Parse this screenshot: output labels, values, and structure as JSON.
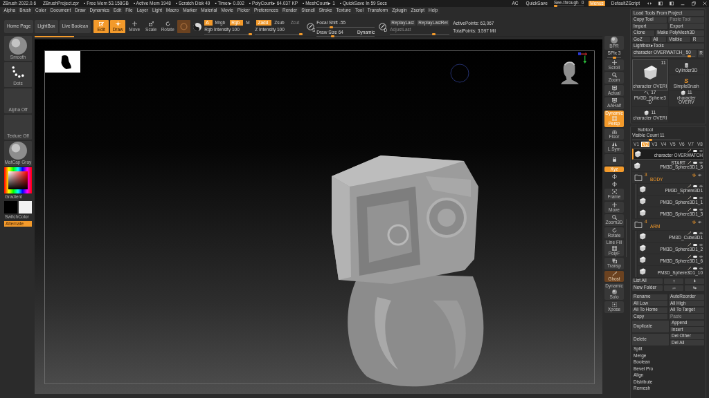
{
  "title_bar": {
    "app": "ZBrush 2022.0.6",
    "project": "ZBrushProject.zpr",
    "stats": [
      "• Free Mem 53.158GB",
      "• Active Mem 1948",
      "• Scratch Disk 49",
      "• Timer▸ 0.002",
      "• PolyCount▸ 64.037 KP",
      "• MeshCount▸ 1",
      "• QuickSave In 59 Secs"
    ],
    "right": {
      "ac": "AC",
      "quicksave": "QuickSave",
      "see_through": {
        "label": "See-through",
        "value": "0",
        "level": 0
      },
      "menus": {
        "label": "Menus",
        "on": true
      },
      "script": "DefaultZScript"
    }
  },
  "menu": [
    "Alpha",
    "Brush",
    "Color",
    "Document",
    "Draw",
    "Dynamics",
    "Edit",
    "File",
    "Layer",
    "Light",
    "Macro",
    "Marker",
    "Material",
    "Movie",
    "Picker",
    "Preferences",
    "Render",
    "Stencil",
    "Stroke",
    "Texture",
    "Tool",
    "Transform",
    "Zplugin",
    "Zscript",
    "Help"
  ],
  "top_shelf": {
    "nav": [
      "Home Page",
      "LightBox",
      "Live Boolean"
    ],
    "modes": [
      {
        "kind": "edit",
        "label": "Edit",
        "selected": true
      },
      {
        "kind": "draw",
        "label": "Draw",
        "selected": true
      },
      {
        "kind": "move",
        "label": "Move",
        "selected": false
      },
      {
        "kind": "scale",
        "label": "Scale",
        "selected": false
      },
      {
        "kind": "rotate",
        "label": "Rotate",
        "selected": false
      }
    ],
    "toggle": {
      "on": true,
      "disabled": true
    },
    "channels": [
      {
        "label": "A",
        "on": true,
        "disabled": false
      },
      {
        "label": "Mrgb",
        "on": false,
        "disabled": false
      },
      {
        "label": "Rgb",
        "on": true,
        "disabled": false
      },
      {
        "label": "M",
        "on": false,
        "disabled": false
      }
    ],
    "z_modes": [
      {
        "label": "Zadd",
        "on": true,
        "disabled": false
      },
      {
        "label": "Zsub",
        "on": false,
        "disabled": false
      },
      {
        "label": "Zcut",
        "on": false,
        "disabled": true
      }
    ],
    "intensity": [
      {
        "label": "Rgb Intensity",
        "value": "100",
        "level": 1
      },
      {
        "label": "Z Intensity",
        "value": "100",
        "level": 1
      }
    ],
    "focal_badge": "S",
    "focal_shift": {
      "label": "Focal Shift",
      "value": "-55",
      "level": 0.24
    },
    "draw_size": {
      "label": "Draw Size",
      "value": "64",
      "level": 0.26,
      "dynamic": "Dynamic"
    },
    "replay_badge": "D",
    "replay": [
      {
        "label": "ReplayLast",
        "disabled": false
      },
      {
        "label": "ReplayLastRel",
        "disabled": false
      }
    ],
    "adjust_last": {
      "label": "AdjustLast",
      "disabled": true,
      "level": 0.75
    },
    "points": [
      "ActivePoints: 63,067",
      "TotalPoints: 3.597 Mil"
    ]
  },
  "left_shelf": {
    "tiles": [
      {
        "kind": "brush",
        "label": "Smooth"
      },
      {
        "kind": "stroke",
        "label": "Dots"
      },
      {
        "kind": "alpha",
        "label": "Alpha Off"
      },
      {
        "kind": "texture",
        "label": "Texture Off"
      },
      {
        "kind": "material",
        "label": "MatCap Gray"
      }
    ],
    "gradient": "Gradient",
    "swatches": [
      {
        "color": "#000000"
      },
      {
        "color": "#f2f2f2"
      }
    ],
    "switch_color": "SwitchColor",
    "alternate": {
      "label": "Alternate",
      "on": true
    }
  },
  "canvas": {
    "progress": {
      "level": 0.07
    }
  },
  "right_shelf": [
    {
      "kind": "sphere",
      "label": "BPR",
      "on": false,
      "disabled": false
    },
    {
      "kind": "slider",
      "label": "SPix 3",
      "level": 0.5
    },
    {
      "kind": "scroll",
      "label": "Scroll",
      "on": false,
      "disabled": false
    },
    {
      "kind": "zoom",
      "label": "Zoom",
      "on": false,
      "disabled": false
    },
    {
      "kind": "actual",
      "label": "Actual",
      "on": false,
      "disabled": false
    },
    {
      "kind": "aahalf",
      "label": "AAHalf",
      "on": false,
      "disabled": false
    },
    {
      "kind": "persp",
      "caption": "Dynamic",
      "label": "Persp",
      "on": true,
      "disabled": false
    },
    {
      "kind": "floor",
      "label": "Floor",
      "on": false,
      "disabled": false
    },
    {
      "kind": "lsym",
      "label": "L.Sym",
      "on": false,
      "disabled": false
    },
    {
      "kind": "lock",
      "on": false,
      "disabled": false
    },
    {
      "kind": "xyz",
      "label": "Xyz",
      "on": true,
      "disabled": false
    },
    {
      "kind": "roty",
      "on": false,
      "disabled": false
    },
    {
      "kind": "rotz",
      "on": false,
      "disabled": false
    },
    {
      "kind": "frame",
      "label": "Frame",
      "on": false,
      "disabled": false
    },
    {
      "kind": "move",
      "label": "Move",
      "on": false,
      "disabled": false
    },
    {
      "kind": "zoom3d",
      "label": "Zoom3D",
      "on": false,
      "disabled": false
    },
    {
      "kind": "rotate",
      "label": "Rotate",
      "on": false,
      "disabled": false
    },
    {
      "kind": "polyf",
      "caption": "Line Fill",
      "label": "PolyF",
      "on": false,
      "disabled": false
    },
    {
      "kind": "transp",
      "label": "Transp",
      "on": false,
      "disabled": false
    },
    {
      "kind": "ghost",
      "label": "Ghost",
      "on": true,
      "disabled": true
    },
    {
      "kind": "solo",
      "caption": "Dynamic",
      "label": "Solo",
      "on": false,
      "disabled": false
    },
    {
      "kind": "xpose",
      "label": "Xpose",
      "on": false,
      "disabled": false
    }
  ],
  "tool_palette": {
    "rows": [
      [
        {
          "label": "Load Tools From Project",
          "disabled": false
        }
      ],
      [
        {
          "label": "Copy Tool",
          "disabled": false
        },
        {
          "label": "Paste Tool",
          "disabled": true
        }
      ],
      [
        {
          "label": "Import",
          "disabled": false
        },
        {
          "label": "Export",
          "disabled": false
        }
      ],
      [
        {
          "label": "Clone",
          "disabled": false
        },
        {
          "label": "Make PolyMesh3D",
          "disabled": false
        }
      ],
      [
        {
          "label": "GoZ",
          "disabled": false
        },
        {
          "label": "All",
          "disabled": false
        },
        {
          "label": "Visible",
          "disabled": false
        },
        {
          "label": "R",
          "disabled": false
        }
      ],
      [
        {
          "label": "Lightbox▸Tools",
          "disabled": false
        }
      ]
    ],
    "current_tool": {
      "label": "character OVERWATCH_",
      "value": "50",
      "level": 0.93,
      "reset": "R"
    },
    "tools": [
      {
        "kind": "character",
        "label": "character OVERI",
        "count": "11",
        "selected": true
      },
      {
        "kind": "cylinder",
        "label": "Cylinder3D",
        "selected": false
      },
      {
        "kind": "brush",
        "label": "SimpleBrush",
        "logo": "S",
        "selected": false
      },
      {
        "kind": "pieces",
        "label": "PM3D_Sphere3D",
        "count": "17",
        "selected": false
      },
      {
        "kind": "character",
        "label": "character OVERV",
        "count": "11",
        "selected": false
      },
      {
        "kind": "character",
        "label": "character OVERI",
        "count": "11",
        "selected": false
      }
    ]
  },
  "subtool": {
    "title": "Subtool",
    "visible_count": {
      "label": "Visible Count",
      "value": "11",
      "level": 0.37
    },
    "versions": [
      {
        "label": "V1",
        "selected": false
      },
      {
        "label": "V2",
        "selected": true
      },
      {
        "label": "V3",
        "selected": false
      },
      {
        "label": "V4",
        "selected": false
      },
      {
        "label": "V5",
        "selected": false
      },
      {
        "label": "V6",
        "selected": false
      },
      {
        "label": "V7",
        "selected": false
      },
      {
        "label": "V8",
        "selected": false
      }
    ],
    "items": [
      {
        "kind": "mesh",
        "name": "character OVERWATCH",
        "selected": true
      },
      {
        "kind": "mesh",
        "name": "PM3D_Sphere3D1_5",
        "note": "START",
        "selected": false
      },
      {
        "kind": "folder",
        "number": "3",
        "name": "BODY",
        "selected": false,
        "children": [
          {
            "kind": "mesh",
            "name": "PM3D_Sphere3D1",
            "selected": false
          },
          {
            "kind": "mesh",
            "name": "PM3D_Sphere3D1_1",
            "selected": false
          },
          {
            "kind": "mesh",
            "name": "PM3D_Sphere3D1_3",
            "selected": false
          }
        ]
      },
      {
        "kind": "folder",
        "number": "4",
        "name": "ARM",
        "selected": false,
        "children": [
          {
            "kind": "mesh",
            "name": "PM3D_Cube3D1",
            "selected": false
          },
          {
            "kind": "mesh",
            "name": "PM3D_Sphere3D1_2",
            "selected": false
          },
          {
            "kind": "mesh",
            "name": "PM3D_Sphere3D1_6",
            "selected": false
          },
          {
            "kind": "mesh",
            "name": "PM3D_Sphere3D1_10",
            "selected": false
          }
        ]
      }
    ],
    "list_all": "List All",
    "new_folder": "New Folder",
    "actions": [
      {
        "kind": "pair",
        "buttons": [
          {
            "label": "Rename",
            "disabled": false
          },
          {
            "label": "AutoReorder",
            "disabled": false
          }
        ]
      },
      {
        "kind": "pair",
        "buttons": [
          {
            "label": "All Low",
            "disabled": false
          },
          {
            "label": "All High",
            "disabled": false
          }
        ]
      },
      {
        "kind": "pair",
        "buttons": [
          {
            "label": "All To Home",
            "disabled": false
          },
          {
            "label": "All To Target",
            "disabled": false
          }
        ]
      },
      {
        "kind": "pair",
        "buttons": [
          {
            "label": "Copy",
            "disabled": false
          },
          {
            "label": "Paste",
            "disabled": true
          }
        ]
      },
      {
        "kind": "split",
        "buttons": [
          {
            "label": "Duplicate",
            "disabled": false
          },
          {
            "label": "Append",
            "disabled": false
          },
          {
            "label": "Insert",
            "disabled": false
          }
        ]
      },
      {
        "kind": "split",
        "buttons": [
          {
            "label": "Delete",
            "disabled": false
          },
          {
            "label": "Del Other",
            "disabled": false
          },
          {
            "label": "Del All",
            "disabled": false
          }
        ]
      },
      {
        "kind": "section",
        "label": "Split"
      },
      {
        "kind": "section",
        "label": "Merge"
      },
      {
        "kind": "section",
        "label": "Boolean"
      },
      {
        "kind": "section",
        "label": "Bevel Pro"
      },
      {
        "kind": "section",
        "label": "Align"
      },
      {
        "kind": "section",
        "label": "Distribute"
      },
      {
        "kind": "section",
        "label": "Remesh"
      }
    ]
  }
}
